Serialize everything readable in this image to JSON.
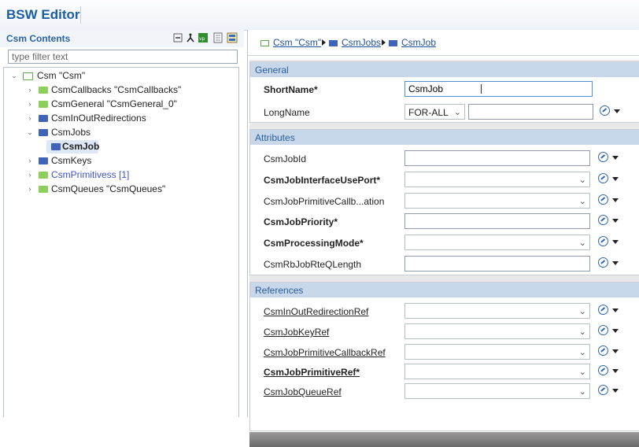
{
  "app": {
    "title": "BSW Editor"
  },
  "left_panel": {
    "title": "Csm Contents",
    "filter_placeholder": "type filter text",
    "toolbar_icons": [
      "collapse-all-icon",
      "link-icon",
      "validation-icon",
      "list-icon",
      "view-menu-icon"
    ],
    "tree": [
      {
        "label": "Csm \"Csm\"",
        "expanded": true,
        "icon": "module-icon"
      },
      {
        "label": "CsmCallbacks \"CsmCallbacks\"",
        "icon": "folder-green-icon"
      },
      {
        "label": "CsmGeneral \"CsmGeneral_0\"",
        "icon": "folder-green-icon"
      },
      {
        "label": "CsmInOutRedirections",
        "icon": "folder-blue-icon"
      },
      {
        "label": "CsmJobs",
        "expanded": true,
        "icon": "folder-blue-icon"
      },
      {
        "label": "CsmJob",
        "selected": true,
        "icon": "folder-blue-icon"
      },
      {
        "label": "CsmKeys",
        "icon": "folder-blue-icon"
      },
      {
        "label": "CsmPrimitivess [1]",
        "icon": "folder-green-icon",
        "color": "#3f53c9"
      },
      {
        "label": "CsmQueues \"CsmQueues\"",
        "icon": "folder-green-icon"
      }
    ]
  },
  "breadcrumb": [
    "Csm \"Csm\"",
    "CsmJobs",
    "CsmJob"
  ],
  "sections": {
    "general": {
      "title": "General",
      "short_name_label": "ShortName*",
      "short_name_value": "CsmJob",
      "long_name_label": "LongName",
      "long_name_lang": "FOR-ALL",
      "long_name_value": ""
    },
    "attributes": {
      "title": "Attributes",
      "rows": [
        {
          "label": "CsmJobId",
          "bold": false,
          "kind": "text",
          "value": ""
        },
        {
          "label": "CsmJobInterfaceUsePort*",
          "bold": true,
          "kind": "combo",
          "value": ""
        },
        {
          "label": "CsmJobPrimitiveCallb...ation",
          "bold": false,
          "kind": "combo",
          "value": ""
        },
        {
          "label": "CsmJobPriority*",
          "bold": true,
          "kind": "text",
          "value": ""
        },
        {
          "label": "CsmProcessingMode*",
          "bold": true,
          "kind": "combo",
          "value": ""
        },
        {
          "label": "CsmRbJobRteQLength",
          "bold": false,
          "kind": "text",
          "value": ""
        }
      ]
    },
    "references": {
      "title": "References",
      "rows": [
        {
          "label": "CsmInOutRedirectionRef",
          "bold": false,
          "value": ""
        },
        {
          "label": "CsmJobKeyRef",
          "bold": false,
          "value": ""
        },
        {
          "label": "CsmJobPrimitiveCallbackRef",
          "bold": false,
          "value": ""
        },
        {
          "label": "CsmJobPrimitiveRef*",
          "bold": true,
          "value": ""
        },
        {
          "label": "CsmJobQueueRef",
          "bold": false,
          "value": ""
        }
      ]
    }
  },
  "colors": {
    "accent": "#1b5ea6",
    "section_header": "#c8d7ea",
    "folder_green": "#8ccf5a",
    "folder_blue": "#3f63b8"
  }
}
